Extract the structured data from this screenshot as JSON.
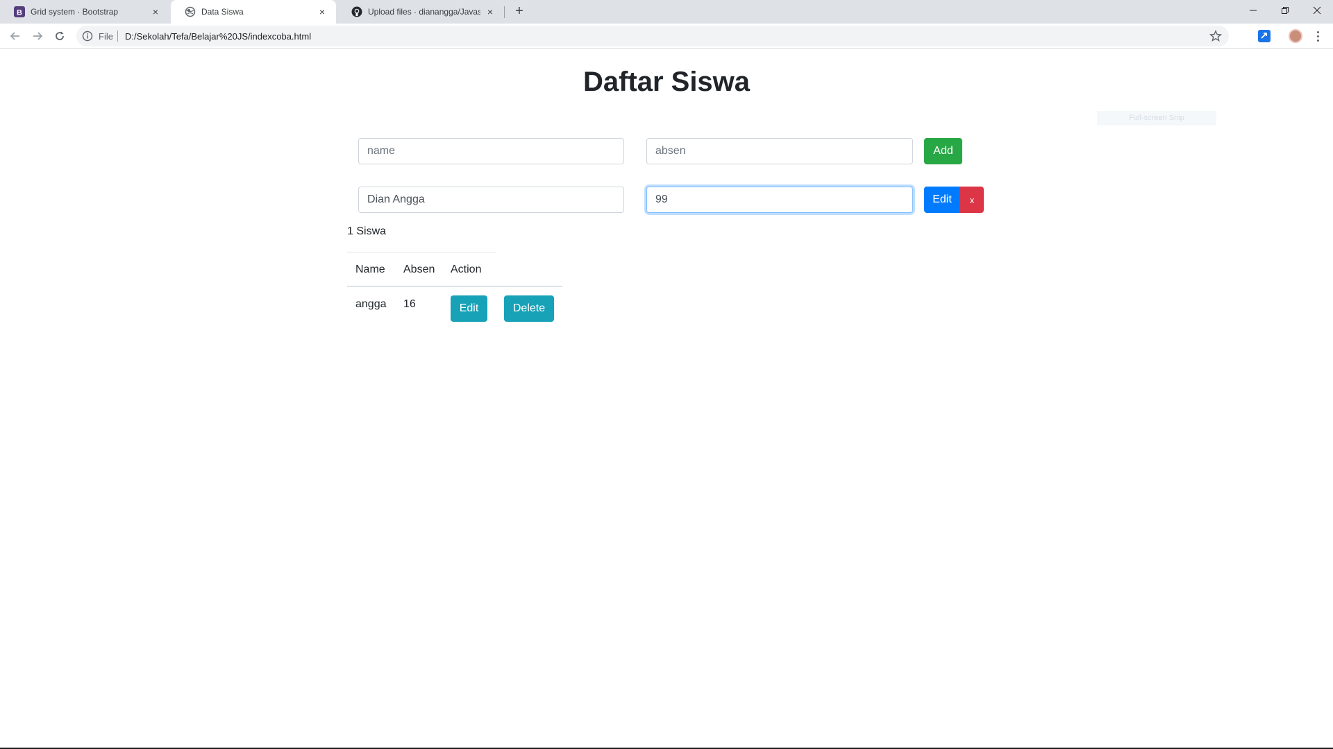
{
  "browser": {
    "tabs": [
      {
        "title": "Grid system · Bootstrap",
        "icon": "bootstrap-icon"
      },
      {
        "title": "Data Siswa",
        "icon": "globe-icon"
      },
      {
        "title": "Upload files · dianangga/Javascri",
        "icon": "github-icon"
      }
    ],
    "close_glyph": "×",
    "new_tab_glyph": "+",
    "scheme_label": "File",
    "url": "D:/Sekolah/Tefa/Belajar%20JS/indexcoba.html"
  },
  "page": {
    "title": "Daftar Siswa",
    "snip_overlay": "Full-screen Snip"
  },
  "add_form": {
    "name_placeholder": "name",
    "absen_placeholder": "absen",
    "add_label": "Add"
  },
  "edit_form": {
    "name_value": "Dian Angga",
    "absen_value": "99",
    "edit_label": "Edit",
    "cancel_label": "x"
  },
  "summary": {
    "count_text": "1 Siswa"
  },
  "table": {
    "headers": [
      "Name",
      "Absen",
      "Action"
    ],
    "rows": [
      {
        "name": "angga",
        "absen": "16",
        "edit_label": "Edit",
        "delete_label": "Delete"
      }
    ]
  },
  "colors": {
    "success": "#28a745",
    "primary": "#007bff",
    "danger": "#dc3545",
    "info": "#17a2b8"
  }
}
